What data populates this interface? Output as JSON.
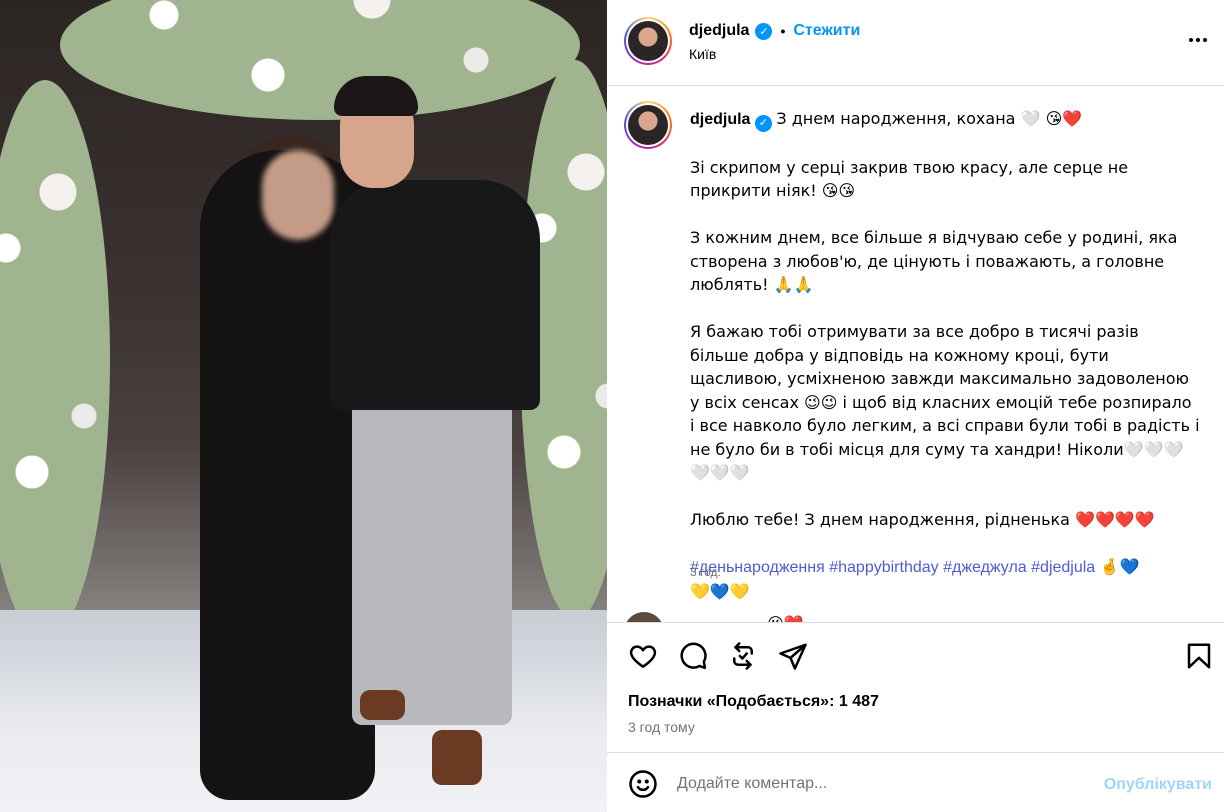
{
  "post": {
    "username": "djedjula",
    "follow_label": "Стежити",
    "dot": "•",
    "location": "Київ"
  },
  "caption": {
    "author": "djedjula",
    "line1": "З днем народження, кохана 🤍 😘❤️",
    "p1": "Зі скрипом у серці закрив твою красу, але серце не прикрити ніяк! 😘😘",
    "p2": "З кожним днем, все більше я відчуваю себе у родині, яка створена з любов'ю, де цінують і поважають, а головне люблять! 🙏🙏",
    "p3": "Я бажаю тобі отримувати за все добро в тисячі разів більше добра у відповідь на кожному кроці, бути щасливою, усміхненою завжди максимально задоволеною у всіх сенсах 😉😉 і щоб від класних емоцій тебе розпирало і все навколо було легким, а всі справи були тобі в радість і не було би в тобі місця для суму та хандри! Ніколи🤍🤍🤍🤍🤍🤍",
    "p4": "Люблю тебе! З днем народження, рідненька ❤️❤️❤️❤️",
    "hashtags": [
      "#деньнародження",
      "#happybirthday",
      "#джеджула",
      "#djedjula"
    ],
    "hashtag_emoji_line1": "🤞💙",
    "hashtag_emoji_line2": "💛💙💛",
    "time": "3 год."
  },
  "next_comment": {
    "preview": "........ .... 😘❤️"
  },
  "actions": {
    "likes_text": "Позначки «Подобається»: 1 487",
    "posted_time": "3 год тому"
  },
  "comment_form": {
    "placeholder": "Додайте коментар...",
    "publish_label": "Опублікувати"
  },
  "colors": {
    "accent": "#0095f6",
    "publish_disabled": "#a2d3fb",
    "secondary_text": "#737373",
    "border": "#dbdbdb"
  },
  "icons": [
    "verified-icon",
    "more-options-icon",
    "like-icon",
    "comment-icon",
    "repost-icon",
    "share-icon",
    "save-icon",
    "emoji-icon"
  ]
}
